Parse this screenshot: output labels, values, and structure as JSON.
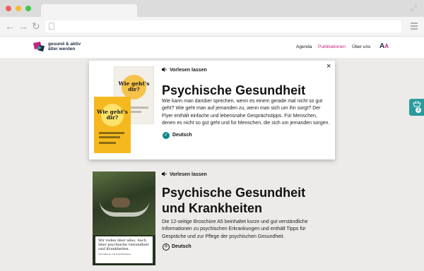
{
  "browser": {
    "window_controls": {
      "close": "#f25f5a",
      "minimize": "#f6bd30",
      "maximize": "#3dc94a"
    }
  },
  "header": {
    "logo_line1": "gesund & aktiv",
    "logo_line2": "älter werden",
    "nav": [
      "Agenda",
      "Publikationen",
      "Über uns"
    ],
    "active_nav": "Publikationen",
    "font_size_control": {
      "big": "A",
      "small": "A"
    }
  },
  "card1": {
    "audio_label": "Vorlesen lassen",
    "close_icon": "×",
    "title": "Psychische Gesundheit",
    "description": "Wie kann man darüber sprechen, wenn es einem gerade mal nicht so gut geht? Wie geht man auf jemanden zu, wenn man sich um ihn sorgt? Der Flyer enthält einfache und lebensnahe Gesprächstipps. Für Menschen, denen es nicht so gut geht und für Menschen, die sich um jemanden sorgen.",
    "language": "Deutsch",
    "language_state": "selected",
    "flyer_title": "Wie geht's dir?"
  },
  "card2": {
    "audio_label": "Vorlesen lassen",
    "title_line1": "Psychische Gesundheit",
    "title_line2": "und Krankheiten",
    "description": "Die 12-seitige Broschüre A5 beinhaltet kurze und gut verständliche Informationen zu psychischen Erkrankungen und enthält Tipps für Gespräche und zur Pflege der psychischen Gesundheit.",
    "language": "Deutsch",
    "language_state": "add",
    "brochure_caption": "Wir reden über alles. Auch über psychische Gesundheit und Krankheiten.",
    "brochure_sub": "Informationen und Gesprächstipps"
  },
  "cart": {
    "count": "2"
  },
  "colors": {
    "brand_pink": "#c6247d",
    "accent_teal": "#2a9b9e",
    "check_teal": "#0c8a8b",
    "flyer_yellow": "#f5b91f"
  }
}
